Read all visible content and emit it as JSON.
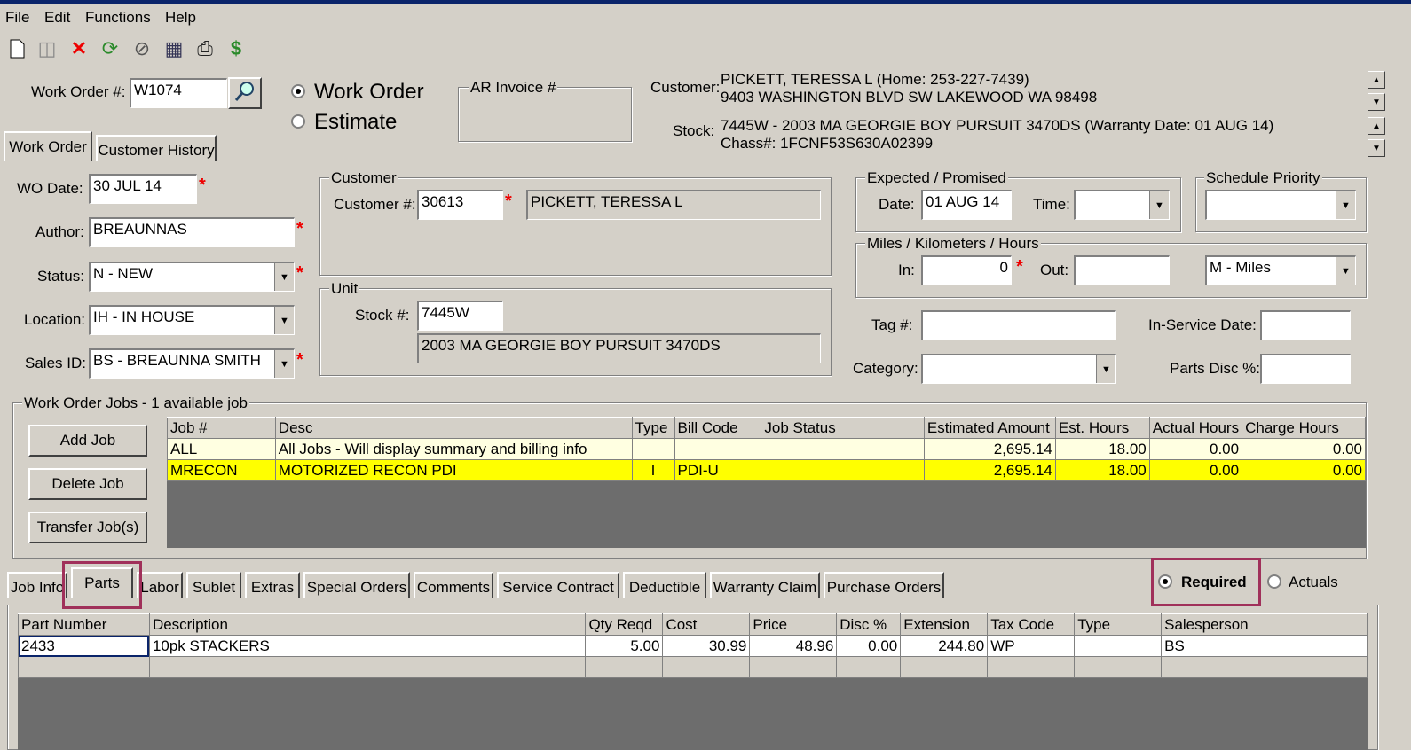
{
  "menu": [
    "File",
    "Edit",
    "Functions",
    "Help"
  ],
  "toolbar_icons": [
    "new-icon",
    "save-icon",
    "delete-icon",
    "refresh-icon",
    "cancel-icon",
    "report-icon",
    "print-icon",
    "money-icon"
  ],
  "header": {
    "wo_label": "Work Order #:",
    "wo_value": "W1074",
    "radio_work_order": "Work Order",
    "radio_estimate": "Estimate",
    "ar_invoice_label": "AR Invoice #",
    "customer_label": "Customer:",
    "customer_line1": "PICKETT, TERESSA L  (Home: 253-227-7439)",
    "customer_line2": "9403 WASHINGTON BLVD SW LAKEWOOD WA 98498",
    "stock_label": "Stock:",
    "stock_line1": "7445W - 2003 MA GEORGIE BOY PURSUIT 3470DS   (Warranty Date: 01 AUG 14)",
    "stock_line2": "Chass#: 1FCNF53S630A02399"
  },
  "top_tabs": [
    "Work Order",
    "Customer History"
  ],
  "form": {
    "wo_date_label": "WO Date:",
    "wo_date": "30 JUL 14",
    "author_label": "Author:",
    "author": "BREAUNNAS",
    "status_label": "Status:",
    "status": "N - NEW",
    "location_label": "Location:",
    "location": "IH - IN HOUSE",
    "sales_label": "Sales ID:",
    "sales": "BS - BREAUNNA SMITH"
  },
  "customer_group": {
    "title": "Customer",
    "num_label": "Customer #:",
    "num": "30613",
    "name": "PICKETT, TERESSA L"
  },
  "unit_group": {
    "title": "Unit",
    "stock_label": "Stock #:",
    "stock": "7445W",
    "desc": "2003 MA GEORGIE BOY PURSUIT 3470DS"
  },
  "expected": {
    "title": "Expected / Promised",
    "date_label": "Date:",
    "date": "01 AUG 14",
    "time_label": "Time:",
    "time": ""
  },
  "schedule": {
    "title": "Schedule Priority",
    "value": ""
  },
  "miles": {
    "title": "Miles / Kilometers / Hours",
    "in_label": "In:",
    "in": "0",
    "out_label": "Out:",
    "out": "",
    "unit": "M - Miles"
  },
  "misc": {
    "tag_label": "Tag #:",
    "inservice_label": "In-Service Date:",
    "category_label": "Category:",
    "partsdisc_label": "Parts Disc %:"
  },
  "jobs": {
    "title": "Work Order Jobs - 1 available job",
    "buttons": [
      "Add Job",
      "Delete Job",
      "Transfer Job(s)"
    ],
    "columns": [
      "Job #",
      "Desc",
      "Type",
      "Bill Code",
      "Job Status",
      "Estimated Amount",
      "Est. Hours",
      "Actual Hours",
      "Charge Hours"
    ],
    "rows": [
      [
        "ALL",
        "All Jobs - Will display summary and billing info",
        "",
        "",
        "",
        "2,695.14",
        "18.00",
        "0.00",
        "0.00"
      ],
      [
        "MRECON",
        "MOTORIZED RECON PDI",
        "I",
        "PDI-U",
        "",
        "2,695.14",
        "18.00",
        "0.00",
        "0.00"
      ]
    ]
  },
  "bottom_tabs": [
    "Job Info",
    "Parts",
    "Labor",
    "Sublet",
    "Extras",
    "Special Orders",
    "Comments",
    "Service Contract",
    "Deductible",
    "Warranty Claim",
    "Purchase Orders"
  ],
  "mode": {
    "required": "Required",
    "actuals": "Actuals"
  },
  "parts": {
    "columns": [
      "Part Number",
      "Description",
      "Qty Reqd",
      "Cost",
      "Price",
      "Disc %",
      "Extension",
      "Tax Code",
      "Type",
      "Salesperson"
    ],
    "rows": [
      [
        "2433",
        "10pk STACKERS",
        "5.00",
        "30.99",
        "48.96",
        "0.00",
        "244.80",
        "WP",
        "",
        "BS"
      ]
    ]
  }
}
